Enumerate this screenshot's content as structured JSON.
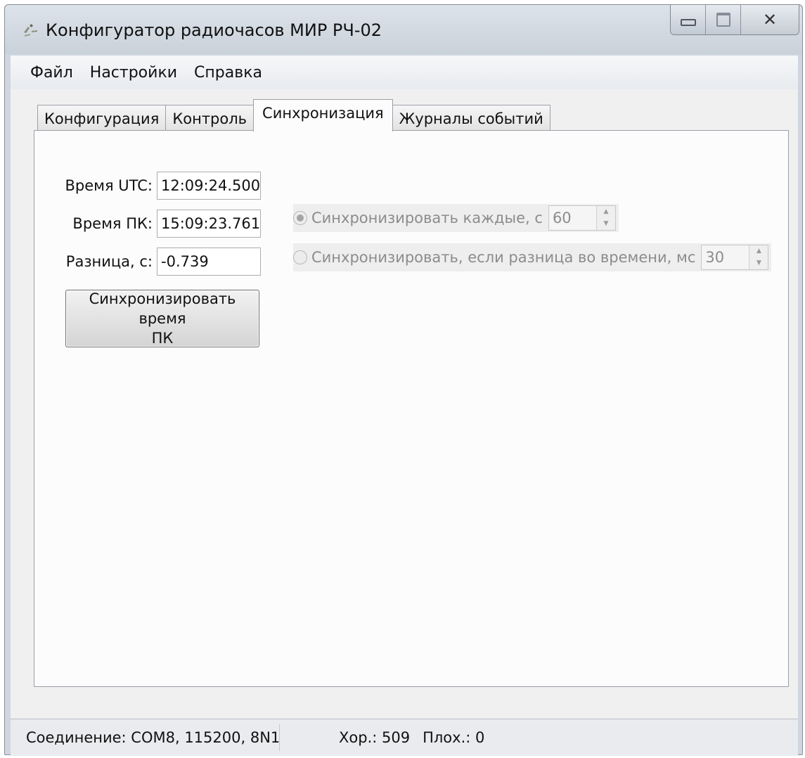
{
  "window": {
    "title": "Конфигуратор радиочасов МИР РЧ-02",
    "close_glyph": "✕"
  },
  "menu": [
    "Файл",
    "Настройки",
    "Справка"
  ],
  "tabs": [
    "Конфигурация",
    "Контроль",
    "Синхронизация",
    "Журналы событий"
  ],
  "active_tab": "Синхронизация",
  "fields": {
    "utc_label": "Время UTC:",
    "utc_value": "12:09:24.500",
    "pc_label": "Время ПК:",
    "pc_value": "15:09:23.761",
    "diff_label": "Разница, с:",
    "diff_value": "-0.739"
  },
  "sync_button": {
    "line1": "Синхронизировать время",
    "line2": "ПК"
  },
  "options": {
    "every_label": "Синхронизировать каждые, с",
    "every_value": "60",
    "every_selected": true,
    "diff_label": "Синхронизировать, если разница во времени, мс",
    "diff_value": "30",
    "diff_selected": false
  },
  "status": {
    "connection": "Соединение: COM8, 115200, 8N1",
    "good": "Хор.: 509",
    "bad": "Плох.: 0"
  }
}
